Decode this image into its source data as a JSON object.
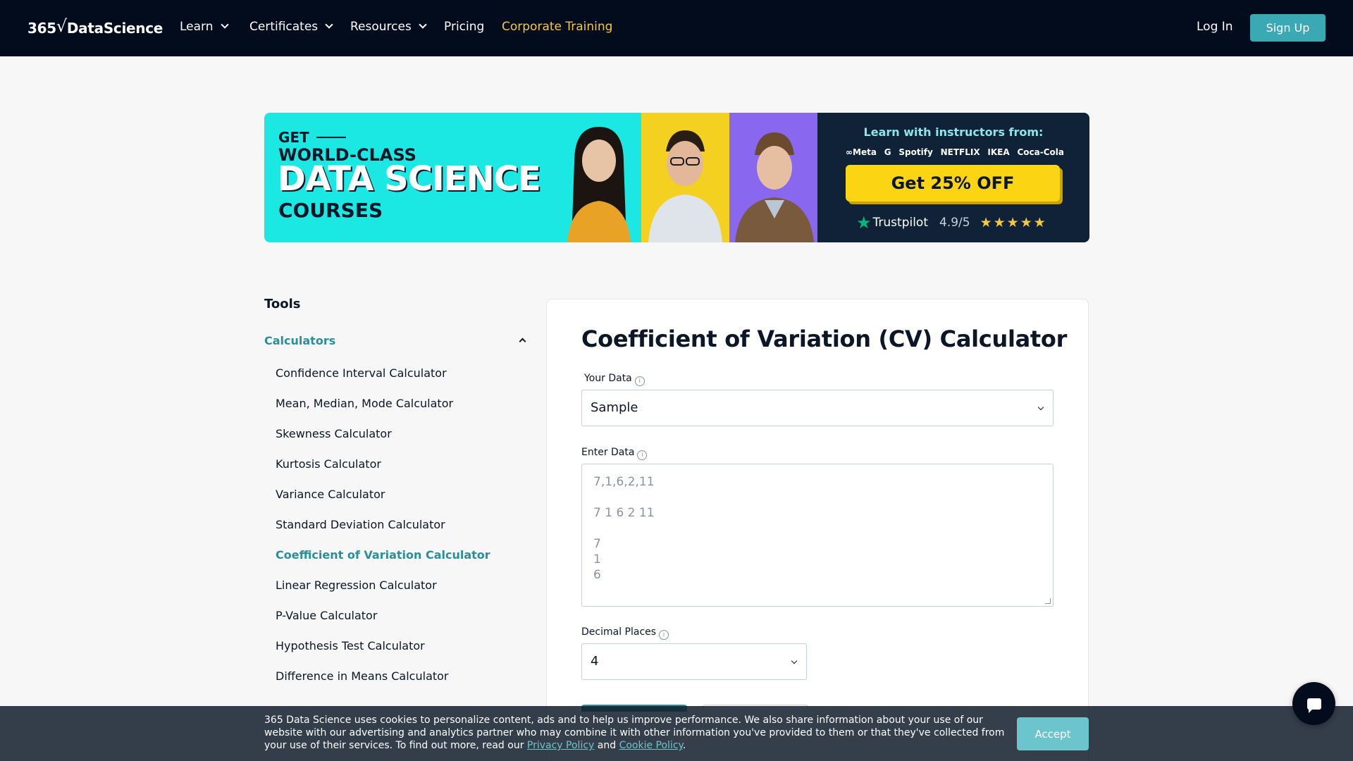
{
  "nav": {
    "logo_prefix": "365",
    "logo_suffix": "DataScience",
    "items": [
      {
        "label": "Learn",
        "dropdown": true
      },
      {
        "label": "Certificates",
        "dropdown": true
      },
      {
        "label": "Resources",
        "dropdown": true
      },
      {
        "label": "Pricing",
        "dropdown": false
      },
      {
        "label": "Corporate Training",
        "dropdown": false
      }
    ],
    "login": "Log In",
    "signup": "Sign Up"
  },
  "banner": {
    "get": "GET",
    "world_class": "WORLD-CLASS",
    "data_science": "DATA SCIENCE",
    "courses": "COURSES",
    "learn_with": "Learn with instructors from:",
    "brands": [
      "∞Meta",
      "G",
      "Spotify",
      "NETFLIX",
      "IKEA",
      "Coca-Cola"
    ],
    "cta": "Get 25% OFF",
    "trustpilot": "Trustpilot",
    "rating": "4.9/5",
    "stars": "★★★★★"
  },
  "sidebar": {
    "title": "Tools",
    "category": "Calculators",
    "items": [
      {
        "label": "Confidence Interval Calculator",
        "active": false
      },
      {
        "label": "Mean, Median, Mode Calculator",
        "active": false
      },
      {
        "label": "Skewness Calculator",
        "active": false
      },
      {
        "label": "Kurtosis Calculator",
        "active": false
      },
      {
        "label": "Variance Calculator",
        "active": false
      },
      {
        "label": "Standard Deviation Calculator",
        "active": false
      },
      {
        "label": "Coefficient of Variation Calculator",
        "active": true
      },
      {
        "label": "Linear Regression Calculator",
        "active": false
      },
      {
        "label": "P-Value Calculator",
        "active": false
      },
      {
        "label": "Hypothesis Test Calculator",
        "active": false
      },
      {
        "label": "Difference in Means Calculator",
        "active": false
      }
    ]
  },
  "calculator": {
    "title": "Coefficient of Variation (CV) Calculator",
    "your_data_label": "Your Data",
    "your_data_value": "Sample",
    "enter_data_label": "Enter Data",
    "enter_data_placeholder_lines": [
      "7,1,6,2,11",
      "",
      "7 1 6 2 11",
      "",
      "7",
      "1",
      "6"
    ],
    "decimal_label": "Decimal Places",
    "decimal_value": "4"
  },
  "cookie": {
    "text": "365 Data Science uses cookies to personalize content, ads and to help us improve performance. We also share information about your use of our website with our advertising and analytics partner who may combine it with other information you've provided to them or that they've collected from your use of their services. To find out more, read our",
    "privacy": "Privacy Policy",
    "and": "and",
    "cookie_policy": "Cookie Policy",
    "end": ".",
    "accept": "Accept"
  },
  "colors": {
    "nav_bg": "#020c1c",
    "accent": "#2a8f99",
    "corporate": "#f5c842",
    "banner_cyan": "#1be8e3",
    "cta_yellow": "#fbd513"
  }
}
